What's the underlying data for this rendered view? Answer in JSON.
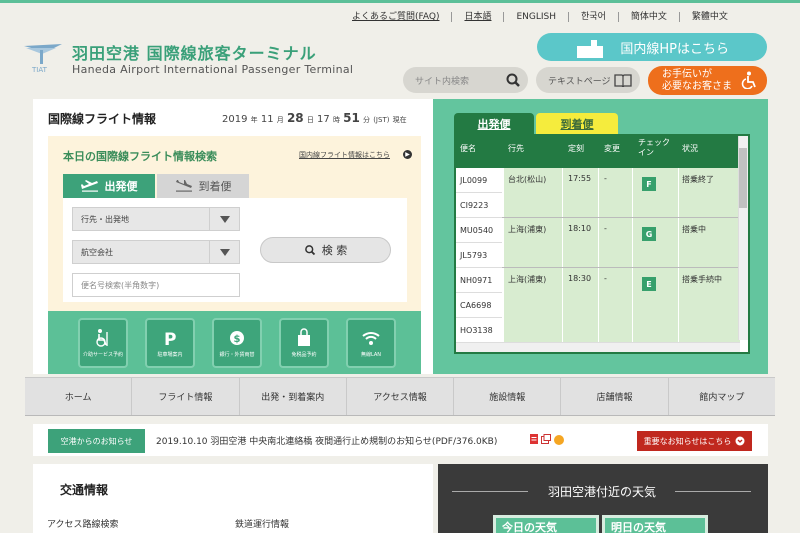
{
  "util_links": [
    "よくあるご質問(FAQ)",
    "日本語",
    "ENGLISH",
    "한국어",
    "簡体中文",
    "繁體中文"
  ],
  "logo": {
    "mark_text": "TIAT",
    "jp": "羽田空港 国際線旅客ターミナル",
    "en": "Haneda Airport International Passenger Terminal"
  },
  "header": {
    "domestic_label": "国内線HPはこちら",
    "search_placeholder": "サイト内検索",
    "text_page_label": "テキストページ",
    "assist_label_1": "お手伝いが",
    "assist_label_2": "必要なお客さま"
  },
  "flight_info": {
    "title": "国際線フライト情報",
    "year": "2019",
    "year_unit": "年",
    "month": "11",
    "month_unit": "月",
    "day": "28",
    "day_unit": "日",
    "hour": "17",
    "hour_unit": "時",
    "minute": "51",
    "minute_unit": "分",
    "tz": "(JST)",
    "now": "現在",
    "search_title": "本日の国際線フライト情報検索",
    "domestic_link": "国内線フライト情報はこちら",
    "tab_dep": "出発便",
    "tab_arr": "到着便",
    "select_dest": "行先・出発地",
    "select_airline": "航空会社",
    "flight_no_placeholder": "便名号検索(半角数字)",
    "search_button": "検 索"
  },
  "services": [
    {
      "icon": "wheelchair-service-icon",
      "label": "介助サービス予約"
    },
    {
      "icon": "parking-icon",
      "label": "駐車場案内"
    },
    {
      "icon": "exchange-icon",
      "label": "銀行・外貨両替"
    },
    {
      "icon": "shopping-bag-icon",
      "label": "免税品予約"
    },
    {
      "icon": "wifi-icon",
      "label": "無線LAN"
    }
  ],
  "board": {
    "tab_dep": "出発便",
    "tab_arr": "到着便",
    "headers": {
      "flight": "便名",
      "dest": "行先",
      "time": "定刻",
      "change": "変更",
      "checkin_1": "チェック",
      "checkin_2": "イン",
      "status": "状況"
    },
    "rows": [
      {
        "flights": [
          "JL0099",
          "CI9223"
        ],
        "dest": "台北(松山)",
        "time": "17:55",
        "change": "-",
        "gate": "F",
        "status": "搭乗終了"
      },
      {
        "flights": [
          "MU0540",
          "JL5793"
        ],
        "dest": "上海(浦東)",
        "time": "18:10",
        "change": "-",
        "gate": "G",
        "status": "搭乗中"
      },
      {
        "flights": [
          "NH0971",
          "CA6698",
          "HO3138"
        ],
        "dest": "上海(浦東)",
        "time": "18:30",
        "change": "-",
        "gate": "E",
        "status": "搭乗手続中"
      }
    ]
  },
  "nav": [
    "ホーム",
    "フライト情報",
    "出発・到着案内",
    "アクセス情報",
    "施設情報",
    "店舗情報",
    "館内マップ"
  ],
  "notice": {
    "label": "空港からのお知らせ",
    "text": "2019.10.10 羽田空港 中央南北連絡橋 夜間通行止め規制のお知らせ(PDF/376.0KB)",
    "important_label": "重要なお知らせはこちら"
  },
  "traffic": {
    "title": "交通情報",
    "access": "アクセス路線検索",
    "rail": "鉄道運行情報"
  },
  "weather": {
    "title": "羽田空港付近の天気",
    "today": "今日の天気",
    "tomorrow": "明日の天気"
  },
  "colors": {
    "brand_green": "#3da27a",
    "board_green": "#237a43",
    "light_green": "#63c59e",
    "accent_yellow": "#f5ec3d",
    "orange": "#ee6f1c",
    "teal": "#5bc7c9",
    "alert_red": "#c0281e"
  }
}
